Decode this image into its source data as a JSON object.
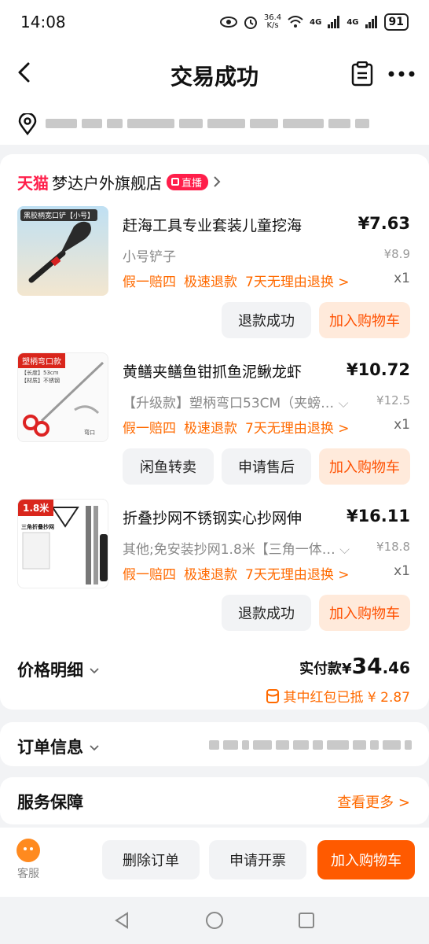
{
  "status_bar": {
    "time": "14:08",
    "speed_value": "36.4",
    "speed_unit": "K/s",
    "network_1": "4G",
    "network_2": "4G",
    "battery": "91"
  },
  "header": {
    "title": "交易成功"
  },
  "shop": {
    "platform": "天猫",
    "name": "梦达户外旗舰店",
    "live_badge": "直播"
  },
  "products": [
    {
      "title": "赶海工具专业套装儿童挖海",
      "price": "¥7.63",
      "sku": "小号铲子",
      "original_price": "¥8.9",
      "tags": [
        "假一赔四",
        "极速退款",
        "7天无理由退换 >"
      ],
      "quantity": "x1",
      "thumb_label": "黑胶柄宽口铲【小号】",
      "buttons": [
        "退款成功",
        "加入购物车"
      ]
    },
    {
      "title": "黄鳝夹鳝鱼钳抓鱼泥鳅龙虾",
      "price": "¥10.72",
      "sku": "【升级款】塑柄弯口53CM（夹螃…",
      "original_price": "¥12.5",
      "tags": [
        "假一赔四",
        "极速退款",
        "7天无理由退换 >"
      ],
      "quantity": "x1",
      "thumb_label": "塑柄弯口款",
      "thumb_spec_1": "【长度】53cm",
      "thumb_spec_2": "【材质】不锈钢",
      "thumb_caption": "弯口",
      "buttons": [
        "闲鱼转卖",
        "申请售后",
        "加入购物车"
      ]
    },
    {
      "title": "折叠抄网不锈钢实心抄网伸",
      "price": "¥16.11",
      "sku": "其他;免安装抄网1.8米【三角一体…",
      "original_price": "¥18.8",
      "tags": [
        "假一赔四",
        "极速退款",
        "7天无理由退换 >"
      ],
      "quantity": "x1",
      "thumb_label": "1.8米",
      "thumb_subtitle": "三角折叠抄网",
      "buttons": [
        "退款成功",
        "加入购物车"
      ]
    }
  ],
  "price_detail": {
    "label": "价格明细",
    "paid_label": "实付款¥",
    "paid_int": "34",
    "paid_dec": ".46",
    "redpack_text": "其中红包已抵 ¥ 2.87"
  },
  "order_info": {
    "label": "订单信息"
  },
  "service": {
    "label": "服务保障",
    "more": "查看更多 >"
  },
  "bottom_bar": {
    "customer_service": "客服",
    "delete_order": "删除订单",
    "invoice": "申请开票",
    "add_to_cart": "加入购物车"
  },
  "colors": {
    "accent": "#ff5a00",
    "tag": "#ff6a00",
    "tmall": "#ff1e4a"
  }
}
